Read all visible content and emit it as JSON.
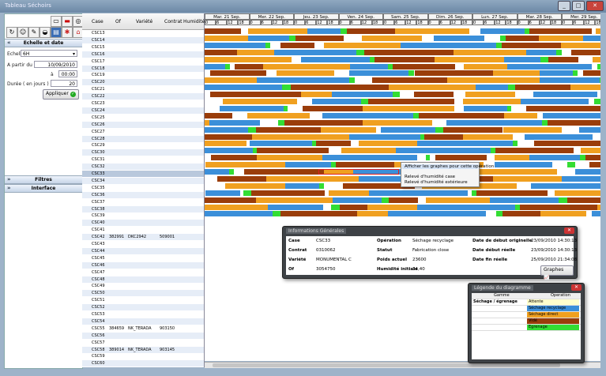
{
  "window": {
    "title": "Tableau Séchoirs",
    "minimize": "_",
    "maximize": "□",
    "close": "✕"
  },
  "left": {
    "section_scale": "Echelle et date",
    "scale_label": "Echelle",
    "scale_value": "6H",
    "from_label": "A partir du",
    "from_date": "10/09/2010",
    "at_label": "à",
    "at_time": "00:00",
    "duration_label": "Durée ( en jours )",
    "duration_value": "20",
    "apply": "Appliquer",
    "filters": "Filtres",
    "interface": "Interface"
  },
  "grid": {
    "headers": [
      "Case",
      "Of",
      "Variété",
      "Contrat",
      "Humidité"
    ],
    "rows": [
      {
        "case": "CSC13"
      },
      {
        "case": "CSC14"
      },
      {
        "case": "CSC15"
      },
      {
        "case": "CSC16"
      },
      {
        "case": "CSC17"
      },
      {
        "case": "CSC18"
      },
      {
        "case": "CSC19"
      },
      {
        "case": "CSC20"
      },
      {
        "case": "CSC21"
      },
      {
        "case": "CSC22"
      },
      {
        "case": "CSC23"
      },
      {
        "case": "CSC24"
      },
      {
        "case": "CSC25"
      },
      {
        "case": "CSC26"
      },
      {
        "case": "CSC27"
      },
      {
        "case": "CSC28"
      },
      {
        "case": "CSC29"
      },
      {
        "case": "CSC30"
      },
      {
        "case": "CSC31"
      },
      {
        "case": "CSC32"
      },
      {
        "case": "CSC33"
      },
      {
        "case": "CSC34"
      },
      {
        "case": "CSC35"
      },
      {
        "case": "CSC36"
      },
      {
        "case": "CSC37"
      },
      {
        "case": "CSC38"
      },
      {
        "case": "CSC39"
      },
      {
        "case": "CSC40"
      },
      {
        "case": "CSC41"
      },
      {
        "case": "CSC42",
        "of": "382991",
        "variete": "DKC2942",
        "contrat": "509001"
      },
      {
        "case": "CSC43"
      },
      {
        "case": "CSC44"
      },
      {
        "case": "CSC45"
      },
      {
        "case": "CSC46"
      },
      {
        "case": "CSC47"
      },
      {
        "case": "CSC48"
      },
      {
        "case": "CSC49"
      },
      {
        "case": "CSC50"
      },
      {
        "case": "CSC51"
      },
      {
        "case": "CSC52"
      },
      {
        "case": "CSC53"
      },
      {
        "case": "CSC54"
      },
      {
        "case": "CSC55",
        "of": "384659",
        "variete": "NK_TERADA",
        "contrat": "903150"
      },
      {
        "case": "CSC56"
      },
      {
        "case": "CSC57"
      },
      {
        "case": "CSC58",
        "of": "389014",
        "variete": "NK_TERADA",
        "contrat": "903145"
      },
      {
        "case": "CSC59"
      },
      {
        "case": "CSC60"
      }
    ]
  },
  "gantt": {
    "days": [
      "Mar. 21 Sep.",
      "Mer. 22 Sep.",
      "Jeu. 23 Sep.",
      "Ven. 24 Sep.",
      "Sam. 25 Sep.",
      "Dim. 26 Sep.",
      "Lun. 27 Sep.",
      "Mar. 28 Sep.",
      "Mer. 29 Sep."
    ],
    "hours": [
      "0",
      "6",
      "12",
      "18"
    ],
    "colors": {
      "attente": "#f0a020",
      "recyclage": "#3b8fd9",
      "direct": "#f0a020",
      "vide": "#9a3d0a",
      "egrenage": "#33dd33"
    }
  },
  "context_menu": {
    "items": [
      "Afficher les graphes pour cette opération",
      "Relevé d'humidité case",
      "Relevé d'humidité extérieure"
    ]
  },
  "info": {
    "title": "Informations Générales",
    "case_label": "Case",
    "case": "CSC33",
    "contrat_label": "Contrat",
    "contrat": "0310062",
    "variete_label": "Variété",
    "variete": "MONUMENTAL C",
    "of_label": "Of",
    "of": "3054750",
    "operation_label": "Opération",
    "operation": "Séchage recyclage",
    "statut_label": "Statut",
    "statut": "Fabrication close",
    "poids_label": "Poids actuel",
    "poids": "23600",
    "humidite_label": "Humidité initiale",
    "humidite": "34,40",
    "debut_orig_label": "Date de début originelle",
    "debut_orig": "23/09/2010 14:30:13",
    "debut_reel_label": "Date début réelle",
    "debut_reel": "23/09/2010 14:30:13",
    "fin_label": "Date fin réelle",
    "fin": "25/09/2010 21:34:08",
    "graphes": "Graphes"
  },
  "legend": {
    "title": "Légende du diagramme",
    "col_gamme": "Gamme",
    "col_operation": "Operation",
    "gamme": "Séchage / égrenage",
    "items": [
      {
        "label": "Attente",
        "color": "#ffffcc"
      },
      {
        "label": "Séchage recyclage",
        "color": "#3b8fd9"
      },
      {
        "label": "Séchage direct",
        "color": "#f0a020"
      },
      {
        "label": "Vidé",
        "color": "#9a3d0a"
      },
      {
        "label": "Egrenage",
        "color": "#33dd33"
      }
    ]
  }
}
